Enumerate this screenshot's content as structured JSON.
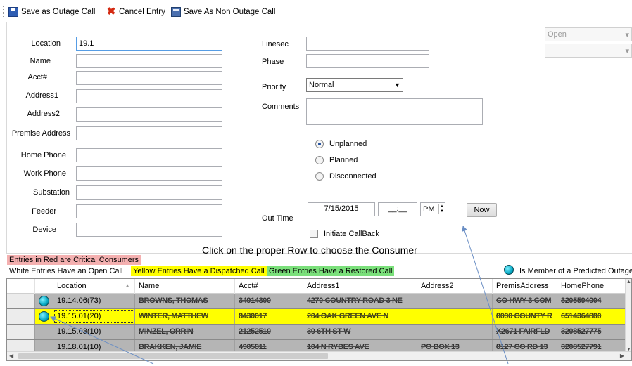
{
  "toolbar": {
    "save_outage": "Save as Outage Call",
    "cancel": "Cancel Entry",
    "save_non_outage": "Save As Non Outage Call"
  },
  "status": {
    "value": "Open",
    "second_value": ""
  },
  "form": {
    "location_label": "Location",
    "location_value": "19.1",
    "name_label": "Name",
    "acct_label": "Acct#",
    "address1_label": "Address1",
    "address2_label": "Address2",
    "premise_label": "Premise Address",
    "home_phone_label": "Home Phone",
    "work_phone_label": "Work Phone",
    "substation_label": "Substation",
    "feeder_label": "Feeder",
    "device_label": "Device",
    "linesec_label": "Linesec",
    "phase_label": "Phase",
    "priority_label": "Priority",
    "priority_value": "Normal",
    "comments_label": "Comments",
    "radio_unplanned": "Unplanned",
    "radio_planned": "Planned",
    "radio_disconnected": "Disconnected",
    "out_time_label": "Out Time",
    "out_date": "7/15/2015",
    "out_time": "__:__",
    "ampm": "PM",
    "now_button": "Now",
    "callback_label": "Initiate CallBack"
  },
  "instructions": "Click on the proper Row  to choose the Consumer",
  "legend": {
    "red": "Entries in Red are Critical Consumers",
    "white": "White Entries Have an Open Call",
    "yellow": "Yellow Entries Have a Dispatched Call",
    "green": "Green Entries Have a Restored Call",
    "predicted": "Is Member of a Predicted Outage"
  },
  "colors": {
    "red_legend": "#f4b0b0",
    "yellow": "#ffff00",
    "green": "#7be07b",
    "row_gray": "#b5b5b5",
    "predicted_dot": "#06a9c5"
  },
  "grid": {
    "columns": [
      "Location",
      "Name",
      "Acct#",
      "Address1",
      "Address2",
      "PremisAddress",
      "HomePhone"
    ],
    "rows": [
      {
        "predicted": true,
        "location": "19.14.06(73)",
        "name": "BROWNS, THOMAS",
        "acct": "34914300",
        "address1": "4270 COUNTRY ROAD 3 NE",
        "address2": "",
        "premis": "CO HWY 3 COM",
        "phone": "3205594004",
        "highlight": "gray"
      },
      {
        "predicted": true,
        "location": "19.15.01(20)",
        "name": "WINTER, MATTHEW",
        "acct": "8430017",
        "address1": "204 OAK GREEN AVE N",
        "address2": "",
        "premis": "8090 COUNTY R",
        "phone": "6514364880",
        "highlight": "yellow"
      },
      {
        "predicted": false,
        "location": "19.15.03(10)",
        "name": "MINZEL, ORRIN",
        "acct": "21252510",
        "address1": "30 6TH ST W",
        "address2": "",
        "premis": "X2671 FAIRFLD",
        "phone": "3208527775",
        "highlight": "gray"
      },
      {
        "predicted": false,
        "location": "19.18.01(10)",
        "name": "BRAKKEN, JAMIE",
        "acct": "4905811",
        "address1": "104 N RYBES AVE",
        "address2": "PO BOX 13",
        "premis": "8127 CO RD 13",
        "phone": "3208527791",
        "highlight": "gray"
      }
    ]
  }
}
